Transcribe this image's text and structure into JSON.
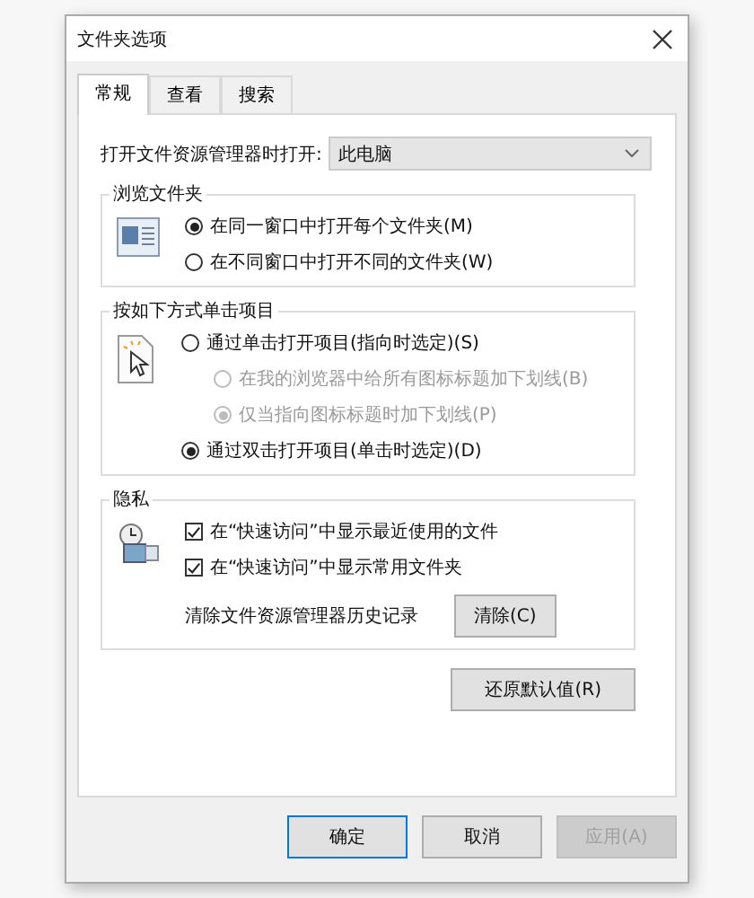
{
  "window": {
    "title": "文件夹选项"
  },
  "tabs": [
    {
      "label": "常规",
      "selected": true
    },
    {
      "label": "查看",
      "selected": false
    },
    {
      "label": "搜索",
      "selected": false
    }
  ],
  "open_explorer": {
    "label": "打开文件资源管理器时打开:",
    "value": "此电脑"
  },
  "browse_folders": {
    "title": "浏览文件夹",
    "options": [
      {
        "label": "在同一窗口中打开每个文件夹(M)",
        "selected": true
      },
      {
        "label": "在不同窗口中打开不同的文件夹(W)",
        "selected": false
      }
    ]
  },
  "click_items": {
    "title": "按如下方式单击项目",
    "options": [
      {
        "label": "通过单击打开项目(指向时选定)(S)",
        "selected": false,
        "children": [
          {
            "label": "在我的浏览器中给所有图标标题加下划线(B)",
            "selected": false,
            "disabled": true
          },
          {
            "label": "仅当指向图标标题时加下划线(P)",
            "selected": true,
            "disabled": true
          }
        ]
      },
      {
        "label": "通过双击打开项目(单击时选定)(D)",
        "selected": true
      }
    ]
  },
  "privacy": {
    "title": "隐私",
    "checkboxes": [
      {
        "label": "在“快速访问”中显示最近使用的文件",
        "checked": true
      },
      {
        "label": "在“快速访问”中显示常用文件夹",
        "checked": true
      }
    ],
    "clear_label": "清除文件资源管理器历史记录",
    "clear_button": "清除(C)"
  },
  "restore_button": "还原默认值(R)",
  "buttons": [
    {
      "label": "确定",
      "default": true,
      "disabled": false
    },
    {
      "label": "取消",
      "default": false,
      "disabled": false
    },
    {
      "label": "应用(A)",
      "default": false,
      "disabled": true
    }
  ]
}
